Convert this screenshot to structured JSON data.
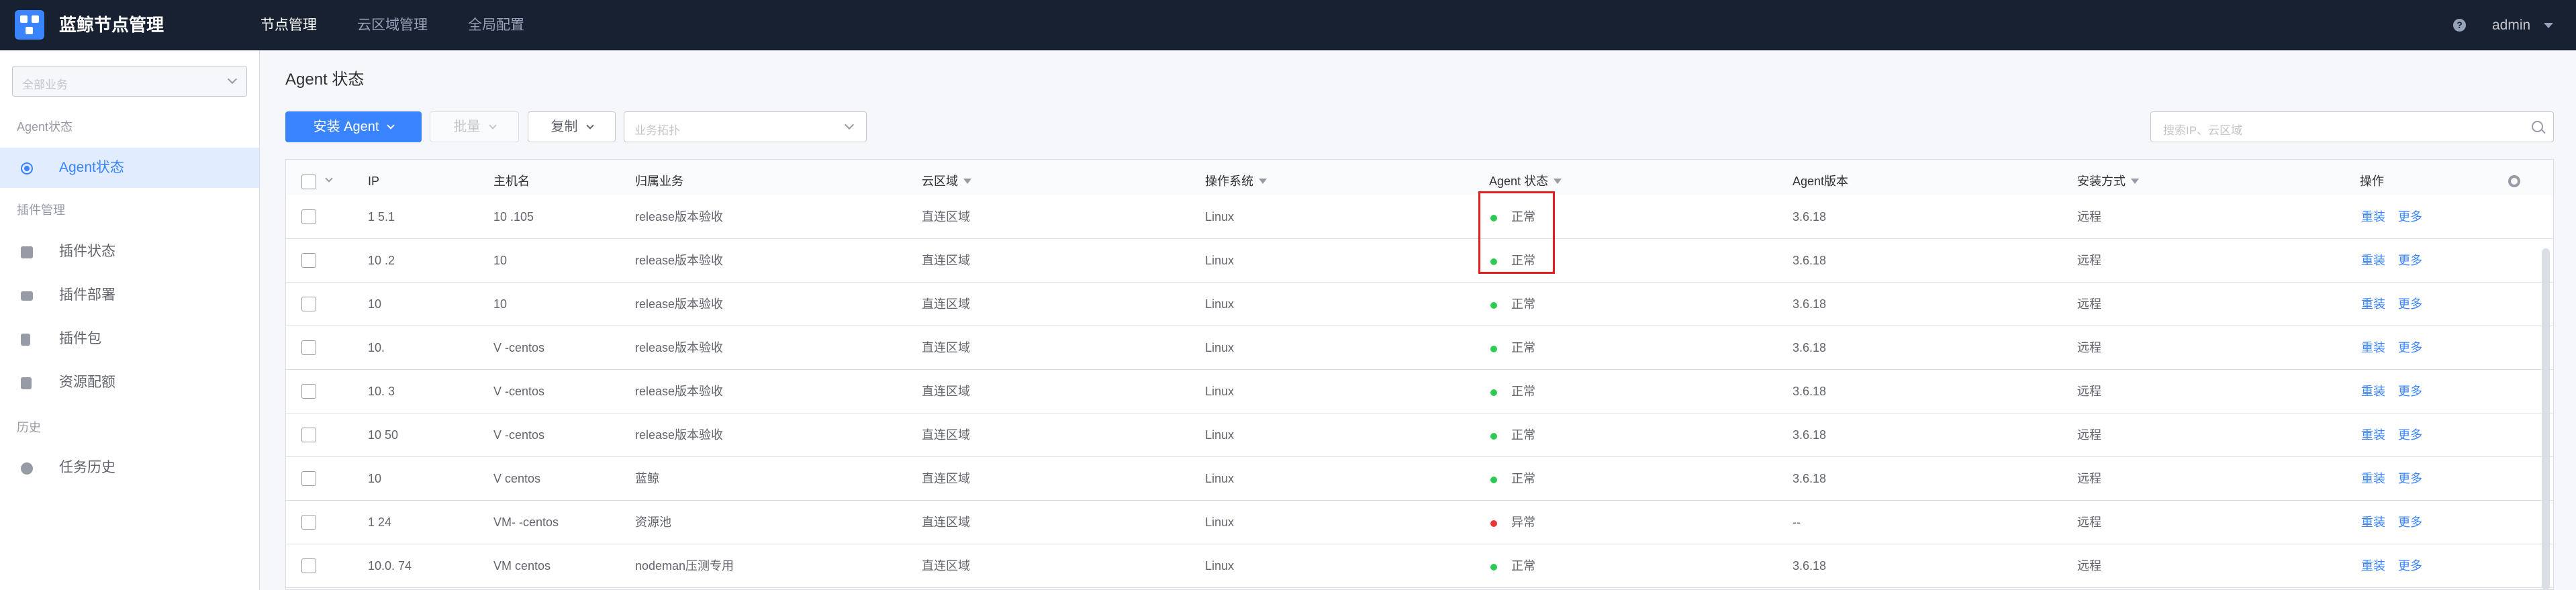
{
  "app": {
    "title": "蓝鲸节点管理"
  },
  "topnav": [
    "节点管理",
    "云区域管理",
    "全局配置"
  ],
  "user": {
    "name": "admin"
  },
  "sidebar": {
    "business_placeholder": "全部业务",
    "groups": [
      {
        "title": "Agent状态",
        "items": [
          {
            "label": "Agent状态",
            "icon": "radio-icon",
            "active": true
          }
        ]
      },
      {
        "title": "插件管理",
        "items": [
          {
            "label": "插件状态",
            "icon": "puzzle-icon"
          },
          {
            "label": "插件部署",
            "icon": "layers-icon"
          },
          {
            "label": "插件包",
            "icon": "package-icon"
          },
          {
            "label": "资源配额",
            "icon": "quota-icon"
          }
        ]
      },
      {
        "title": "历史",
        "items": [
          {
            "label": "任务历史",
            "icon": "clock-icon"
          }
        ]
      }
    ]
  },
  "page": {
    "title": "Agent 状态"
  },
  "toolbar": {
    "install_label": "安装 Agent",
    "batch_label": "批量",
    "copy_label": "复制",
    "topo_placeholder": "业务拓扑",
    "search_placeholder": "搜索IP、云区域"
  },
  "table": {
    "columns": [
      "IP",
      "主机名",
      "归属业务",
      "云区域",
      "操作系统",
      "Agent 状态",
      "Agent版本",
      "安装方式",
      "操作"
    ],
    "rows": [
      {
        "ip": "1   5.1  ",
        "hostname": "10    .105",
        "biz": "release版本验收",
        "cloud": "直连区域",
        "os": "Linux",
        "status": "正常",
        "ok": true,
        "version": "3.6.18",
        "install": "远程"
      },
      {
        "ip": "10    .2  ",
        "hostname": "10",
        "biz": "release版本验收",
        "cloud": "直连区域",
        "os": "Linux",
        "status": "正常",
        "ok": true,
        "version": "3.6.18",
        "install": "远程"
      },
      {
        "ip": "10",
        "hostname": "10",
        "biz": "release版本验收",
        "cloud": "直连区域",
        "os": "Linux",
        "status": "正常",
        "ok": true,
        "version": "3.6.18",
        "install": "远程"
      },
      {
        "ip": "10.",
        "hostname": "V           -centos",
        "biz": "release版本验收",
        "cloud": "直连区域",
        "os": "Linux",
        "status": "正常",
        "ok": true,
        "version": "3.6.18",
        "install": "远程"
      },
      {
        "ip": "10.         3",
        "hostname": "V           -centos",
        "biz": "release版本验收",
        "cloud": "直连区域",
        "os": "Linux",
        "status": "正常",
        "ok": true,
        "version": "3.6.18",
        "install": "远程"
      },
      {
        "ip": "10        50",
        "hostname": "V          -centos",
        "biz": "release版本验收",
        "cloud": "直连区域",
        "os": "Linux",
        "status": "正常",
        "ok": true,
        "version": "3.6.18",
        "install": "远程"
      },
      {
        "ip": "10",
        "hostname": "V        centos",
        "biz": "蓝鲸",
        "cloud": "直连区域",
        "os": "Linux",
        "status": "正常",
        "ok": true,
        "version": "3.6.18",
        "install": "远程"
      },
      {
        "ip": "1         24",
        "hostname": "VM-         -centos",
        "biz": "资源池",
        "cloud": "直连区域",
        "os": "Linux",
        "status": "异常",
        "ok": false,
        "version": "--",
        "install": "远程"
      },
      {
        "ip": "10.0.  74",
        "hostname": "VM         centos",
        "biz": "nodeman压测专用",
        "cloud": "直连区域",
        "os": "Linux",
        "status": "正常",
        "ok": true,
        "version": "3.6.18",
        "install": "远程"
      }
    ],
    "actions": {
      "reinstall": "重装",
      "more": "更多"
    }
  },
  "colors": {
    "accent": "#3a84ff",
    "ok": "#2dcb56",
    "error": "#ea3636",
    "topbar": "#182132",
    "highlight": "#e02020"
  }
}
